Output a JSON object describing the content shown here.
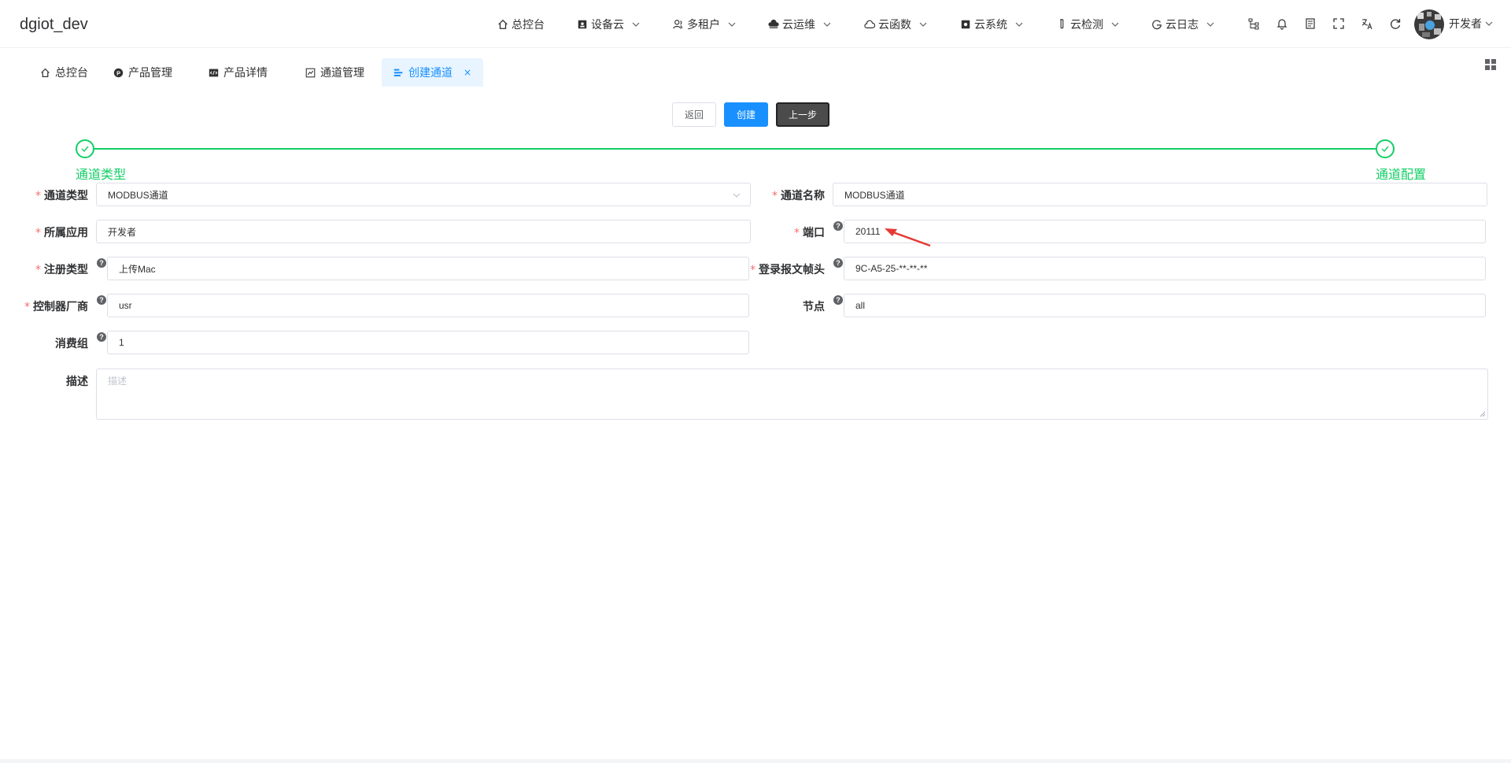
{
  "header": {
    "brand": "dgiot_dev",
    "nav": [
      {
        "label": "总控台",
        "icon": "home-icon",
        "dropdown": false
      },
      {
        "label": "设备云",
        "icon": "device-icon",
        "dropdown": true
      },
      {
        "label": "多租户",
        "icon": "users-icon",
        "dropdown": true
      },
      {
        "label": "云运维",
        "icon": "cloud-ops-icon",
        "dropdown": true
      },
      {
        "label": "云函数",
        "icon": "cloud-icon",
        "dropdown": true
      },
      {
        "label": "云系统",
        "icon": "system-icon",
        "dropdown": true
      },
      {
        "label": "云检测",
        "icon": "test-tube-icon",
        "dropdown": true
      },
      {
        "label": "云日志",
        "icon": "log-icon",
        "dropdown": true
      }
    ],
    "tools": [
      "tree-icon",
      "bell-icon",
      "book-icon",
      "fullscreen-icon",
      "translate-icon",
      "refresh-icon"
    ],
    "user": "开发者"
  },
  "tabs": [
    {
      "label": "总控台",
      "icon": "home-icon",
      "active": false
    },
    {
      "label": "产品管理",
      "icon": "product-icon",
      "active": false
    },
    {
      "label": "产品详情",
      "icon": "code-icon",
      "active": false
    },
    {
      "label": "通道管理",
      "icon": "chart-icon",
      "active": false
    },
    {
      "label": "创建通道",
      "icon": "align-icon",
      "active": true
    }
  ],
  "actions": {
    "back": "返回",
    "create": "创建",
    "prev": "上一步"
  },
  "steps": {
    "step1": "通道类型",
    "step2": "通道配置"
  },
  "form": {
    "channel_type": {
      "label": "通道类型",
      "value": "MODBUS通道"
    },
    "channel_name": {
      "label": "通道名称",
      "value": "MODBUS通道"
    },
    "app": {
      "label": "所属应用",
      "value": "开发者"
    },
    "port": {
      "label": "端口",
      "value": "20111"
    },
    "register_type": {
      "label": "注册类型",
      "value": "上传Mac"
    },
    "login_header": {
      "label": "登录报文帧头",
      "value": "9C-A5-25-**-**-**"
    },
    "vendor": {
      "label": "控制器厂商",
      "value": "usr"
    },
    "node": {
      "label": "节点",
      "value": "all"
    },
    "consumer_group": {
      "label": "消费组",
      "value": "1"
    },
    "description": {
      "label": "描述",
      "placeholder": "描述"
    }
  },
  "colors": {
    "primary": "#1890ff",
    "success": "#13ce66",
    "required": "#f56c6c",
    "annotation": "#e53935"
  }
}
